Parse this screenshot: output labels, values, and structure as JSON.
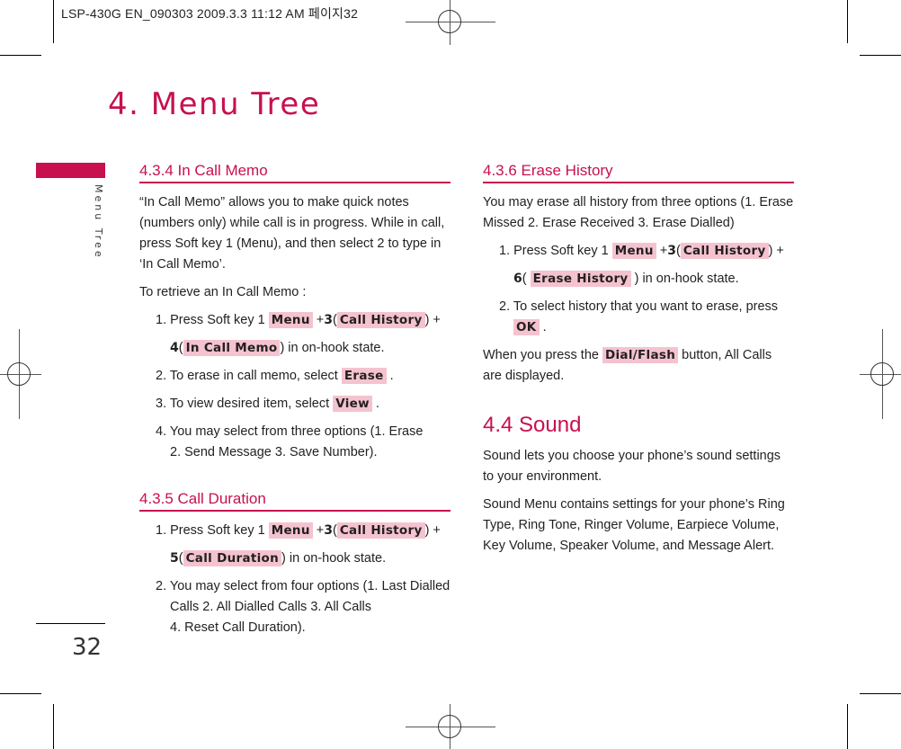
{
  "slug": {
    "text": "LSP-430G EN_090303  2009.3.3 11:12 AM  페이지32"
  },
  "chapter_title": "4. Menu Tree",
  "side_label": "Menu Tree",
  "page_number": "32",
  "colors": {
    "accent": "#c8104e",
    "key_highlight": "#f4c3cf"
  },
  "sections": {
    "in_call_memo": {
      "heading": "4.3.4 In Call Memo",
      "intro": "“In Call Memo” allows you to make quick notes (numbers only) while call is in progress. While in call, press Soft key 1 (Menu), and then select 2 to type in ‘In Call Memo’.",
      "retrieve": "To retrieve an In Call Memo :",
      "step1": {
        "prefix": "1. Press Soft key 1",
        "key1": "Menu",
        "plus": "+",
        "num1": "3",
        "key2": "Call History",
        "num2": "4",
        "key3": "In Call Memo",
        "suffix": "in on-hook state."
      },
      "step2": {
        "text": "2. To erase in call memo, select",
        "key": "Erase"
      },
      "step3": {
        "text": "3. To view desired item, select",
        "key": "View"
      },
      "step4": {
        "line1": "4. You may select from three options (1. Erase",
        "line2": "2. Send Message  3. Save Number)."
      }
    },
    "call_duration": {
      "heading": "4.3.5 Call Duration",
      "step1": {
        "prefix": "1. Press Soft key 1",
        "key1": "Menu",
        "plus": "+",
        "num1": "3",
        "key2": "Call History",
        "num2": "5",
        "key3": "Call Duration",
        "suffix": "in on-hook state."
      },
      "step2": {
        "line1": "2. You may select from four options (1. Last Dialled",
        "line2": "Calls   2. All Dialled Calls   3. All Calls",
        "line3": "4. Reset Call Duration)."
      }
    },
    "erase_history": {
      "heading": "4.3.6 Erase History",
      "intro": "You may erase all history from three options (1. Erase Missed   2. Erase Received   3. Erase Dialled)",
      "step1": {
        "prefix": "1. Press Soft key 1",
        "key1": "Menu",
        "plus": "+",
        "num1": "3",
        "key2": "Call History",
        "num2": "6",
        "key3": "Erase History",
        "suffix": "in on-hook state."
      },
      "step2": {
        "text": "2. To select history that you want to erase, press",
        "key": "OK"
      },
      "dial": {
        "prefix": "When you press the",
        "key": "Dial/Flash",
        "suffix": "button, All Calls are displayed."
      }
    },
    "sound": {
      "heading": "4.4 Sound",
      "para1": "Sound lets you choose your phone’s sound settings to your environment.",
      "para2": "Sound Menu contains settings for your phone’s Ring Type, Ring Tone, Ringer Volume, Earpiece Volume, Key Volume, Speaker Volume, and Message Alert."
    }
  }
}
